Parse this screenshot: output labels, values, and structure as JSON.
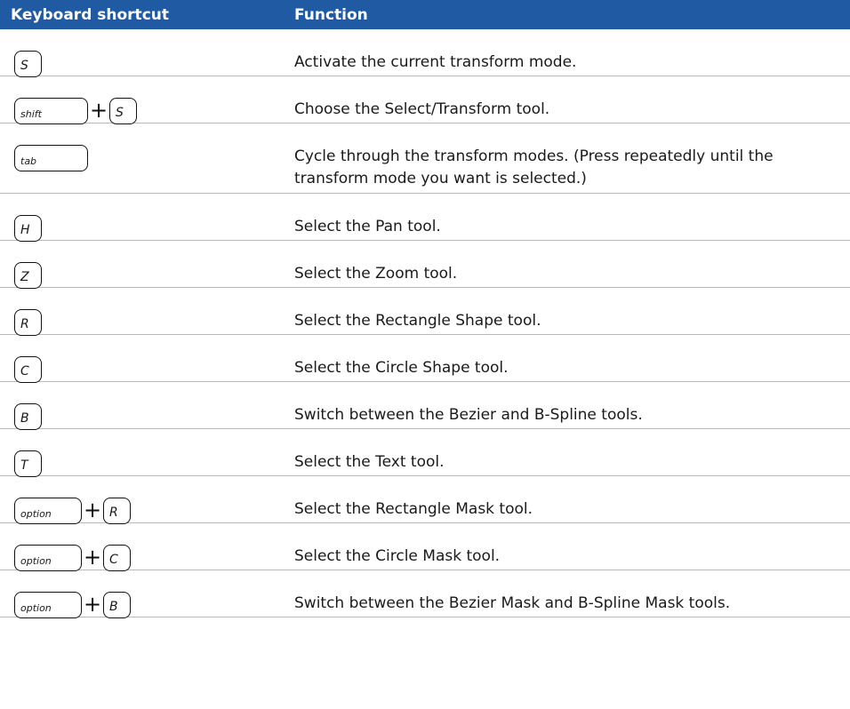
{
  "header": {
    "col1": "Keyboard shortcut",
    "col2": "Function"
  },
  "rows": [
    {
      "keys": [
        {
          "label": "S",
          "kind": "letter"
        }
      ],
      "function": "Activate the current transform mode."
    },
    {
      "keys": [
        {
          "label": "shift",
          "kind": "mod"
        },
        {
          "label": "S",
          "kind": "letter"
        }
      ],
      "function": "Choose the Select/Transform tool."
    },
    {
      "keys": [
        {
          "label": "tab",
          "kind": "mod"
        }
      ],
      "function": "Cycle through the transform modes. (Press repeatedly until the transform mode you want is selected.)"
    },
    {
      "keys": [
        {
          "label": "H",
          "kind": "letter"
        }
      ],
      "function": "Select the Pan tool."
    },
    {
      "keys": [
        {
          "label": "Z",
          "kind": "letter"
        }
      ],
      "function": "Select the Zoom tool."
    },
    {
      "keys": [
        {
          "label": "R",
          "kind": "letter"
        }
      ],
      "function": "Select the Rectangle Shape tool."
    },
    {
      "keys": [
        {
          "label": "C",
          "kind": "letter"
        }
      ],
      "function": "Select the Circle Shape tool."
    },
    {
      "keys": [
        {
          "label": "B",
          "kind": "letter"
        }
      ],
      "function": "Switch between the Bezier and B-Spline tools."
    },
    {
      "keys": [
        {
          "label": "T",
          "kind": "letter"
        }
      ],
      "function": "Select the Text tool."
    },
    {
      "keys": [
        {
          "label": "option",
          "kind": "mod"
        },
        {
          "label": "R",
          "kind": "letter"
        }
      ],
      "function": "Select the Rectangle Mask tool."
    },
    {
      "keys": [
        {
          "label": "option",
          "kind": "mod"
        },
        {
          "label": "C",
          "kind": "letter"
        }
      ],
      "function": "Select the Circle Mask tool."
    },
    {
      "keys": [
        {
          "label": "option",
          "kind": "mod"
        },
        {
          "label": "B",
          "kind": "letter"
        }
      ],
      "function": "Switch between the Bezier Mask and B-Spline Mask tools."
    }
  ],
  "plus_symbol": "+",
  "colors": {
    "header_bg": "#1f5aa3",
    "header_text": "#ffffff",
    "divider": "#b9b9b9"
  }
}
